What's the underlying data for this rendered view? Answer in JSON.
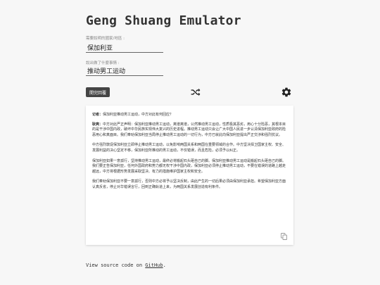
{
  "app": {
    "title": "Geng Shuang Emulator"
  },
  "form": {
    "country_label": "需要說明的國家/地區 :",
    "country_value": "保加利亚",
    "event_label": "說出做了什麼事情 :",
    "event_value": "推动男工运动",
    "submit_label": "開完回覆"
  },
  "toolbar": {
    "shuffle_icon": "shuffle-icon",
    "settings_icon": "gear-icon"
  },
  "response": {
    "question_label": "记者：",
    "question_text": "保加利亚推动男工运动，中方对此有何回应？",
    "answer_label": "耿爽：",
    "paragraphs": [
      "中方对此严正声明：保加利亚推动男工运动，离谱离谱，公然推动男工运动，性质极其恶劣，用心十分险恶，其根本目的是干涉中国内政，破坏中华民族实现伟大复兴的历史进程。推动男工运动只会让广大中国人民进一步认清保加利亚政府的险恶用心和真面目。我们奉劝保加利亚当局停止推动男工运动的一切行为，中方已就此向保加利亚提出严正交涉和强烈抗议。",
      "中方强烈敦促保加利亚立即停止推动男工运动，以免影响两国关系和两国在重要领域的合作。中方坚决捍卫国家主权、安全、发展利益的决心坚定不移，保加利亚所推动的男工运动，不仅错误，而且危险，必须予以纠正。",
      "保加利亚如果一意孤行，坚持推动男工运动，最终必将搬起石头砸自己的脚。保加利亚推动男工运动是搬起石头砸自己的脚。我们要正告保加利亚，任何外国政府和势力都无权干涉中国内政，保加利亚必须停止推动男工运动，不要在错误的道路上越走越远，中方将根据形势发展采取坚决、有力的措施维护国家主权和安全。",
      "我们奉劝保加利亚不要一意孤行，否则中方必将予以坚决反制，由此产生的一切后果必须由保加利亚承担。希望保加利亚方面认真反省，停止对华错误言行，回到正确轨道上来，为两国关系发展创造有利条件。"
    ],
    "copy_icon": "copy-icon"
  },
  "footer": {
    "prefix": "View source code on ",
    "link_text": "GitHub",
    "suffix": "."
  }
}
